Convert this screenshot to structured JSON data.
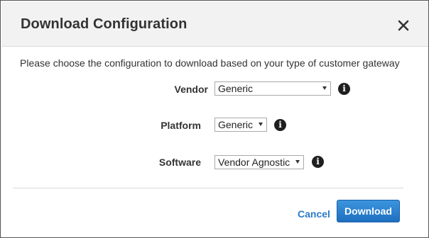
{
  "dialog": {
    "title": "Download Configuration",
    "intro": "Please choose the configuration to download based on your type of customer gateway"
  },
  "form": {
    "vendor": {
      "label": "Vendor",
      "value": "Generic"
    },
    "platform": {
      "label": "Platform",
      "value": "Generic"
    },
    "software": {
      "label": "Software",
      "value": "Vendor Agnostic"
    }
  },
  "icons": {
    "close": "close-icon",
    "info": "info-icon",
    "info_glyph": "i"
  },
  "footer": {
    "cancel_label": "Cancel",
    "download_label": "Download"
  },
  "colors": {
    "accent": "#2b7bc7",
    "primary_button": "#1e6fc0"
  }
}
